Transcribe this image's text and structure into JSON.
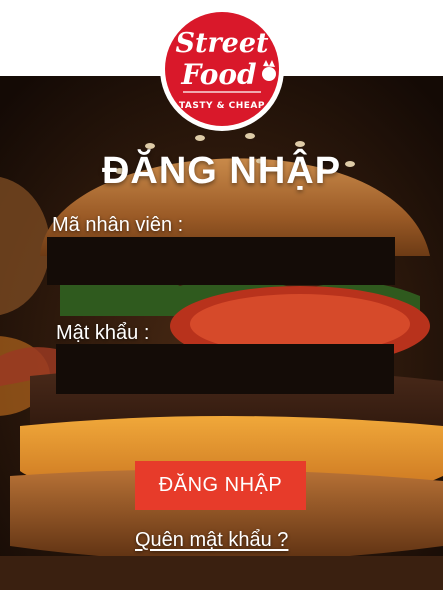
{
  "logo": {
    "line1": "Street",
    "line2": "Food",
    "tagline": "TASTY & CHEAP",
    "colors": {
      "red": "#d9182a",
      "white": "#ffffff"
    }
  },
  "login": {
    "title": "ĐĂNG NHẬP",
    "employee_id_label": "Mã nhân viên :",
    "employee_id_value": "",
    "password_label": "Mật khẩu :",
    "password_value": "",
    "submit_label": "ĐĂNG NHẬP",
    "forgot_label": "Quên mật khẩu ?"
  },
  "colors": {
    "accent": "#e73b2a",
    "field_bg": "#140c07",
    "text": "#ffffff"
  }
}
